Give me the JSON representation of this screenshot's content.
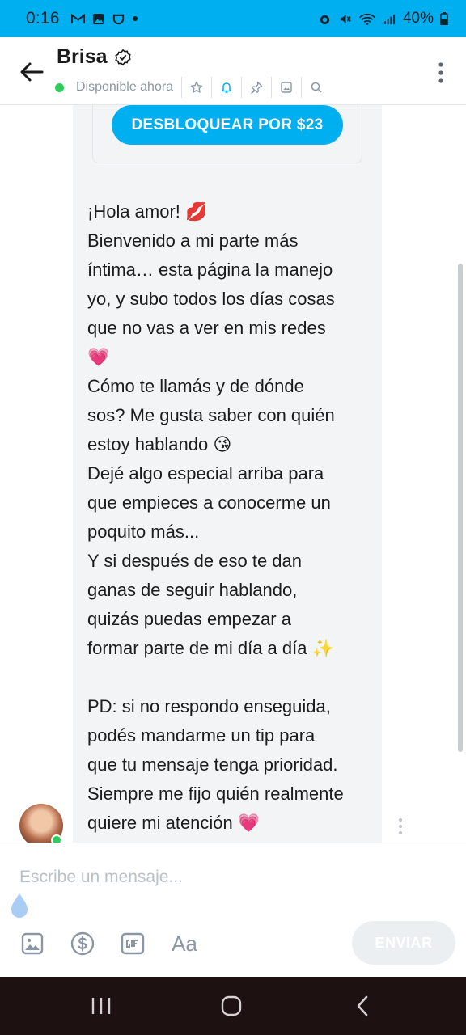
{
  "status_bar": {
    "time": "0:16",
    "battery": "40%",
    "left_icons": [
      "gmail-icon",
      "gallery-icon",
      "app-icon",
      "dot-icon"
    ],
    "right_icons": [
      "alarm-icon",
      "mute-icon",
      "wifi-icon",
      "signal-icon",
      "battery-icon"
    ]
  },
  "header": {
    "name": "Brisa",
    "status": "Disponible ahora",
    "icons": [
      "star-icon",
      "bell-icon",
      "pin-icon",
      "image-icon",
      "search-icon"
    ]
  },
  "chat": {
    "unlock_button": "DESBLOQUEAR POR $23",
    "message_lines": [
      "¡Hola amor! 💋",
      "Bienvenido a mi parte más",
      "íntima… esta página la manejo",
      "yo, y subo todos los días cosas",
      "que no vas a ver en mis redes",
      "💗",
      "Cómo te llamás y de dónde",
      "sos? Me gusta saber con quién",
      "estoy hablando 😘",
      "Dejé algo especial arriba para",
      "que empieces a conocerme un",
      "poquito más...",
      "Y si después de eso te dan",
      "ganas de seguir hablando,",
      "quizás puedas empezar a",
      "formar parte de mi día a día ✨",
      "",
      "PD: si no respondo enseguida,",
      "podés mandarme un tip para",
      "que tu mensaje tenga prioridad.",
      "Siempre me fijo quién realmente",
      "quiere mi atención 💗"
    ]
  },
  "composer": {
    "placeholder": "Escribe un mensaje...",
    "send_label": "ENVIAR",
    "format_label": "Aa",
    "tools": [
      "image-icon",
      "dollar-icon",
      "gif-icon",
      "text-format-icon"
    ]
  },
  "colors": {
    "accent": "#00aff0",
    "online": "#2ecc5b",
    "bubble": "#f2f4f5",
    "muted": "#8a96a3"
  }
}
